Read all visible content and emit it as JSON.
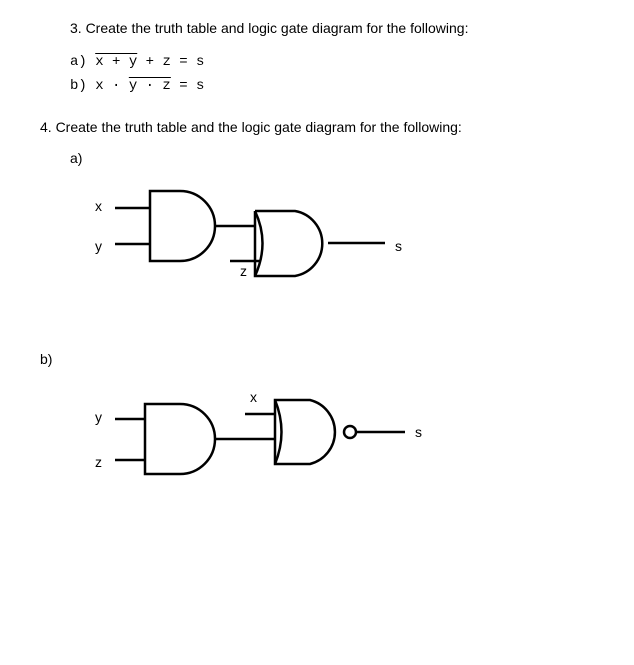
{
  "q3": {
    "header": "3.   Create the truth table and logic gate diagram for the following:",
    "eq_a_prefix": "a) ",
    "eq_a_part1": "x + y",
    "eq_a_part2": " + z = s",
    "eq_b_prefix": "b) ",
    "eq_b_part1": "x · ",
    "eq_b_part2": "y · z",
    "eq_b_part3": " = s"
  },
  "q4": {
    "header": "4. Create the truth table and the logic gate diagram for the following:",
    "part_a": "a)",
    "part_b": "b)"
  },
  "diagram_a": {
    "input_x": "x",
    "input_y": "y",
    "input_z": "z",
    "output_s": "s"
  },
  "diagram_b": {
    "input_y": "y",
    "input_z": "z",
    "input_x": "x",
    "output_s": "s"
  }
}
